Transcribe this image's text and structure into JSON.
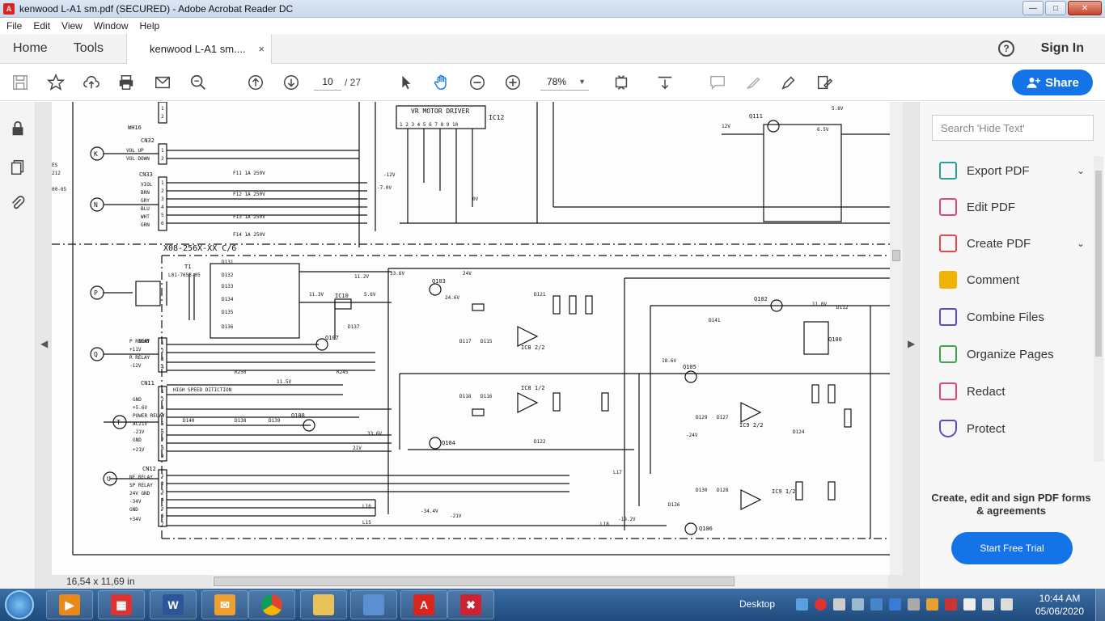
{
  "window": {
    "title": "kenwood L-A1 sm.pdf (SECURED) - Adobe Acrobat Reader DC",
    "app_icon": "acrobat-icon",
    "buttons": [
      "minimize",
      "maximize",
      "close"
    ]
  },
  "menu": [
    "File",
    "Edit",
    "View",
    "Window",
    "Help"
  ],
  "tabs": {
    "home": "Home",
    "tools": "Tools",
    "document": "kenwood L-A1 sm....",
    "close": "×"
  },
  "header": {
    "help": "?",
    "signin": "Sign In"
  },
  "toolbar": {
    "page_current": "10",
    "page_total": "/ 27",
    "zoom": "78%",
    "zoom_caret": "▼",
    "share": "Share"
  },
  "document": {
    "page_size": "16,54 x 11,69 in",
    "labels": {
      "vr_motor_driver": "VR MOTOR DRIVER",
      "ic12": "IC12",
      "board": "X08-256X-XX C/6",
      "cn32": "CN32",
      "cn33": "CN33",
      "cn11": "CN11",
      "cn12": "CN12",
      "wh16": "WH16",
      "wh8": "WH8",
      "vol_up": "VOL UP",
      "vol_down": "VOL DOWN",
      "q111": "Q111",
      "q103": "Q103",
      "q107": "Q107",
      "q108": "Q108",
      "q104": "Q104",
      "q105": "Q105",
      "q106": "Q106",
      "q102": "Q102",
      "q100": "Q100",
      "ic10": "IC10",
      "ic8a": "IC8 2/2",
      "ic8b": "IC8 1/2",
      "ic9a": "IC9 2/2",
      "ic9b": "IC9 1/2",
      "t1": "T1",
      "l01": "L01-7653-05",
      "f11": "F11 1A 250V",
      "f12": "F12 1A 250V",
      "f13": "F13 1A 250V",
      "f14": "F14 1A 250V",
      "high_speed": "HIGH SPEED DITICTION",
      "p_relay": "P RELAY",
      "plus11": "+11V",
      "r_relay": "R RELAY",
      "minus12": "-12V",
      "v_minus12": "-12V",
      "v_minus7": "-7.0V",
      "v_5_8": "5.8V",
      "v_6_5": "6.5V",
      "v_12": "12V",
      "v_11_2": "11.2V",
      "v_33_6": "33.6V",
      "v_24": "24V",
      "v_24_6": "24.6V",
      "v_11_3": "11.3V",
      "v_5_6": "5.6V",
      "v_11_5": "11.5V",
      "v_18_6": "18.6V",
      "v_minus24": "-24V",
      "v_minus34": "-34.4V",
      "v_minus21": "-21V",
      "v_minus19": "-19.2V",
      "v_11_0": "11.0V",
      "v_21": "21V",
      "v_33_6b": "33.6V",
      "v_0": "0V",
      "r250": "R250",
      "r245": "R245",
      "l17": "L17",
      "l16": "L16",
      "l15": "L15",
      "l18": "L18",
      "d131": "D131",
      "d132": "D132",
      "d133": "D133",
      "d134": "D134",
      "d135": "D135",
      "d136": "D136",
      "d137": "D137",
      "d138": "D138",
      "d139": "D139",
      "d140": "D140",
      "d117": "D117",
      "d115": "D115",
      "d118": "D118",
      "d116": "D116",
      "d121": "D121",
      "d122": "D122",
      "d129": "D129",
      "d127": "D127",
      "d130": "D130",
      "d128": "D128",
      "d126": "D126",
      "d124": "D124",
      "d141": "D141",
      "d112": "D112",
      "k": "K",
      "n": "N",
      "p": "P",
      "q": "Q",
      "t": "T",
      "u": "U",
      "nf_relay": "NF RELAY",
      "sp_relay": "SP RELAY",
      "gnd_24v": "24V GND",
      "minus34": "-34V",
      "gnd": "GND",
      "plus34": "+34V",
      "power_relay": "POWER RELAY",
      "ac21v": "AC21V",
      "minus21v": "-21V",
      "plus21v": "+21V",
      "plus5_6": "+5.6V",
      "side_es": "ES",
      "side_212": "212",
      "side_05": "00-05",
      "vmd_pin_nums": "1 2 3 4 5 6 7 8 9 10",
      "cn33_pins": [
        "VIOL",
        "BRN",
        "GRY",
        "BLU",
        "WHT",
        "GRN"
      ],
      "cn11_pins": [
        "GND",
        "+5.6V",
        "POWER RELAY",
        "AC21V",
        "-21V",
        "GND",
        "+21V"
      ],
      "pin_numbers": [
        "1",
        "2",
        "3",
        "4",
        "5",
        "6",
        "7",
        "8",
        "9"
      ]
    }
  },
  "right_pane": {
    "search_placeholder": "Search 'Hide Text'",
    "items": [
      {
        "label": "Export PDF",
        "color": "#2aa198"
      },
      {
        "label": "Edit PDF",
        "color": "#e0457b"
      },
      {
        "label": "Create PDF",
        "color": "#e34850"
      },
      {
        "label": "Comment",
        "color": "#f0b400"
      },
      {
        "label": "Combine Files",
        "color": "#5b4cc4"
      },
      {
        "label": "Organize Pages",
        "color": "#3da74e"
      },
      {
        "label": "Redact",
        "color": "#e0457b"
      },
      {
        "label": "Protect",
        "color": "#5b4cc4"
      }
    ],
    "chevron": "⌄",
    "promo": "Create, edit and sign PDF forms & agreements",
    "trial": "Start Free Trial"
  },
  "taskbar": {
    "desktop": "Desktop",
    "time": "10:44 AM",
    "date": "05/06/2020",
    "word_glyph": "W",
    "pdf_glyph": "A"
  },
  "colors": {
    "accent": "#1473e6",
    "schematic": "#111111"
  }
}
